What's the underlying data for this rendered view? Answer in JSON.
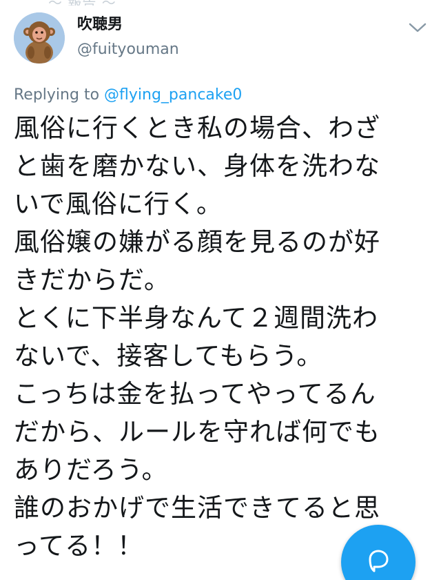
{
  "colors": {
    "accent": "#1da1f2",
    "text": "#14171a",
    "secondary": "#657786"
  },
  "top_fragment": "～ 報告 ～",
  "user": {
    "display_name": "吹聴男",
    "handle": "@fuityouman",
    "avatar_icon": "monkey-avatar-icon"
  },
  "reply": {
    "prefix": "Replying to",
    "mention": "@flying_pancake0"
  },
  "tweet": {
    "lines": [
      "風俗に行くとき私の場合、わざ",
      "と歯を磨かない、身体を洗わな",
      "いで風俗に行く。",
      "風俗嬢の嫌がる顔を見るのが好",
      "きだからだ。",
      "とくに下半身なんて２週間洗わ",
      "ないで、接客してもらう。",
      "こっちは金を払ってやってるん",
      "だから、ルールを守れば何でも",
      "ありだろう。",
      "誰のおかげで生活できてると思",
      "ってる！！"
    ]
  },
  "actions": {
    "menu_icon": "chevron-down-icon",
    "compose_icon": "reply-bubble-icon"
  }
}
